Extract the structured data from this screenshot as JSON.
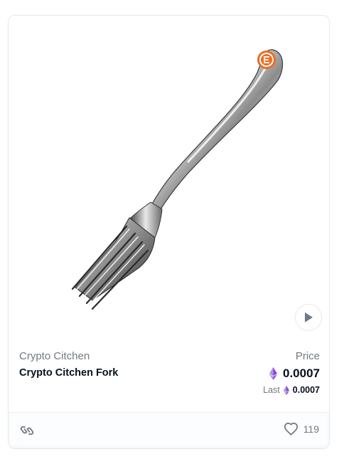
{
  "card": {
    "collection_name": "Crypto Citchen",
    "item_name": "Crypto Citchen Fork",
    "price_label": "Price",
    "price_value": "0.0007",
    "last_label": "Last",
    "last_value": "0.0007",
    "favorite_count": "119"
  },
  "icons": {
    "media": "fork-image",
    "play": "play-icon",
    "currency": "eth-icon",
    "chain": "chain-link-icon",
    "favorite": "heart-icon"
  },
  "colors": {
    "eth_purple": "#8247e5",
    "brand_orange": "#f06a1f",
    "text_primary": "#04111d",
    "text_secondary": "#707a83"
  }
}
